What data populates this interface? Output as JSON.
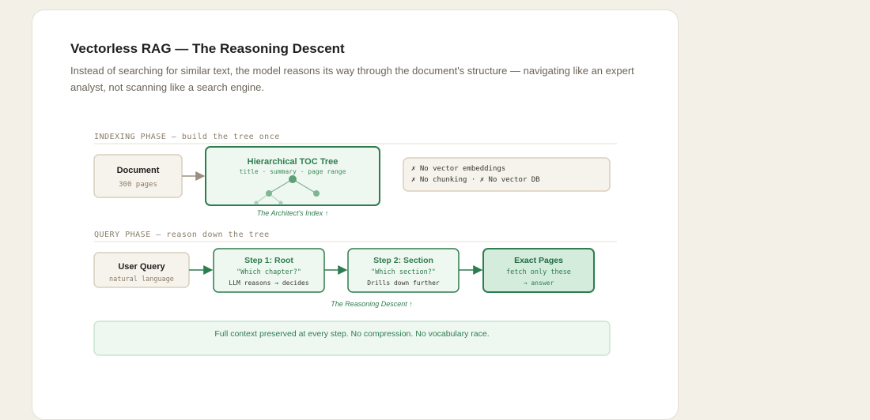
{
  "header": {
    "title": "Vectorless RAG — The Reasoning Descent",
    "subtitle": "Instead of searching for similar text, the model reasons its way through the document's structure — navigating like an expert analyst, not scanning like a search engine."
  },
  "indexing": {
    "label": "INDEXING PHASE — build the tree once",
    "document": {
      "title": "Document",
      "detail": "300 pages"
    },
    "toc": {
      "title": "Hierarchical TOC Tree",
      "detail": "title · summary · page range"
    },
    "caption": "The Architect's Index ↑",
    "notes": [
      "✗ No vector embeddings",
      "✗ No chunking · ✗ No vector DB"
    ]
  },
  "query": {
    "label": "QUERY PHASE — reason down the tree",
    "user_query": {
      "title": "User Query",
      "detail": "natural language"
    },
    "step1": {
      "title": "Step 1: Root",
      "question": "\"Which chapter?\"",
      "detail": "LLM reasons → decides"
    },
    "step2": {
      "title": "Step 2: Section",
      "question": "\"Which section?\"",
      "detail": "Drills down further"
    },
    "exact": {
      "title": "Exact Pages",
      "line1": "fetch only these",
      "line2": "→ answer"
    },
    "caption": "The Reasoning Descent ↑"
  },
  "footer": {
    "text": "Full context preserved at every step. No compression. No vocabulary race."
  },
  "colors": {
    "green": "#2e7d4f",
    "green_fill": "#eef7f0",
    "green_strong_fill": "#d4ecdc",
    "beige_fill": "#f6f3ec",
    "beige_stroke": "#d9cfbd",
    "arrow_gray": "#9a8f7e"
  }
}
